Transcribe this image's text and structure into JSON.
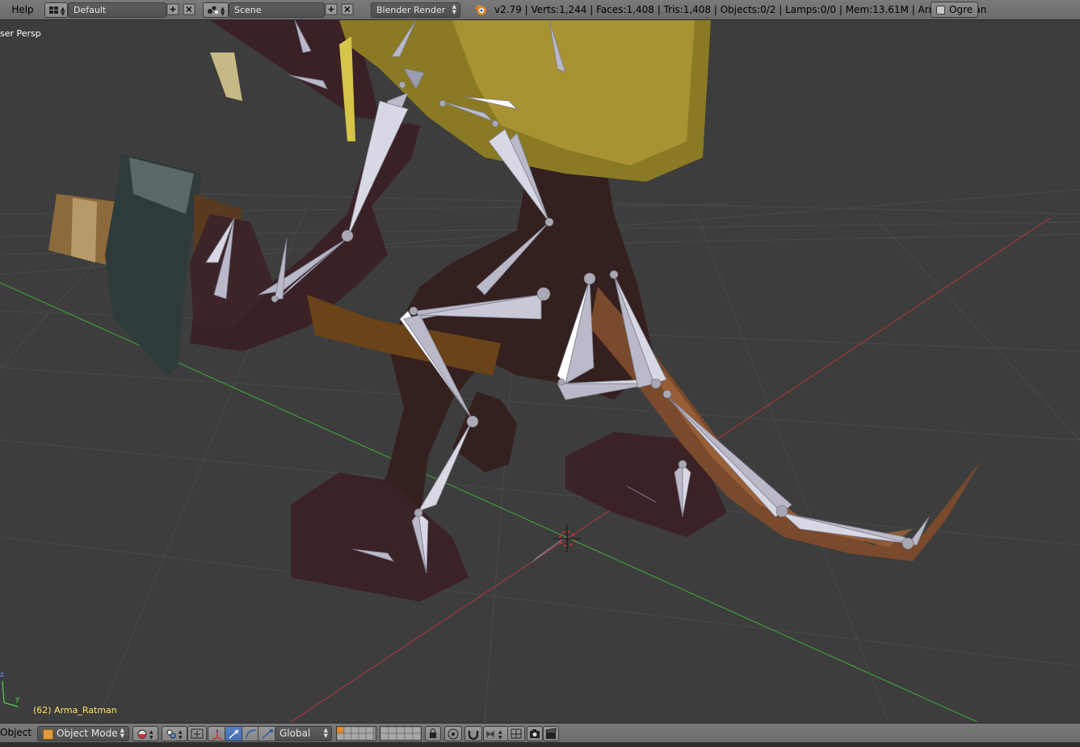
{
  "header": {
    "help_menu": "Help",
    "screen_layout": "Default",
    "scene": "Scene",
    "render_engine": "Blender Render",
    "stats": "v2.79 | Verts:1,244 | Faces:1,408 | Tris:1,408 | Objects:0/2 | Lamps:0/0 | Mem:13.61M | Arma_Ratman",
    "ogre_label": "Ogre",
    "icons": {
      "layout": "screen-layout-icon",
      "scene": "scene-icon",
      "add": "add-icon",
      "close": "close-icon",
      "logo": "blender-logo-icon"
    }
  },
  "viewport": {
    "view_label": "ser Persp",
    "active_object": "(62) Arma_Ratman",
    "axis_y": "y",
    "axis_z": "z"
  },
  "footer": {
    "object_menu": "Object",
    "mode": "Object Mode",
    "orientation": "Global"
  },
  "colors": {
    "grid_bg": "#3d3d3d",
    "x_axis": "#b03a3a",
    "y_axis": "#3c9a3c",
    "bone": "#b9b9c9",
    "header_bg": "#727272",
    "active_object_text": "#ffe36a"
  }
}
